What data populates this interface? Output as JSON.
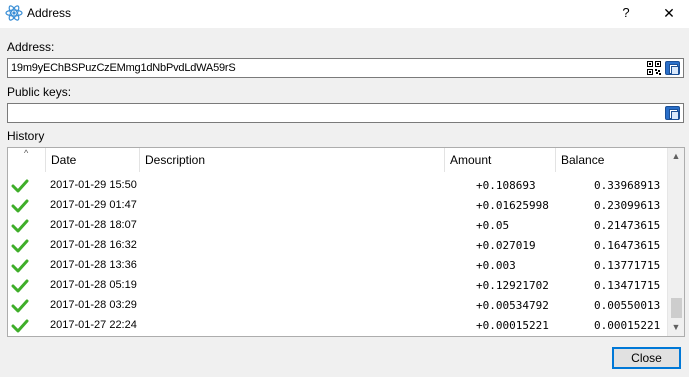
{
  "window": {
    "title": "Address",
    "help_label": "?",
    "close_label": "✕",
    "icon": "electrum-icon"
  },
  "address": {
    "label": "Address:",
    "value": "19m9yEChBSPuzCzEMmg1dNbPvdLdWA59rS",
    "qr_icon": "qr-code-icon",
    "copy_icon": "copy-icon"
  },
  "public_keys": {
    "label": "Public keys:",
    "value": "",
    "copy_icon": "copy-icon"
  },
  "history": {
    "label": "History",
    "columns": [
      "Date",
      "Description",
      "Amount",
      "Balance"
    ],
    "rows": [
      {
        "status": "confirmed-check-icon",
        "date": "2017-01-29 15:50",
        "description": "",
        "amount": "+0.108693",
        "balance": "0.33968913"
      },
      {
        "status": "confirmed-check-icon",
        "date": "2017-01-29 01:47",
        "description": "",
        "amount": "+0.01625998",
        "balance": "0.23099613"
      },
      {
        "status": "confirmed-check-icon",
        "date": "2017-01-28 18:07",
        "description": "",
        "amount": "+0.05",
        "balance": "0.21473615"
      },
      {
        "status": "confirmed-check-icon",
        "date": "2017-01-28 16:32",
        "description": "",
        "amount": "+0.027019",
        "balance": "0.16473615"
      },
      {
        "status": "confirmed-check-icon",
        "date": "2017-01-28 13:36",
        "description": "",
        "amount": "+0.003",
        "balance": "0.13771715"
      },
      {
        "status": "confirmed-check-icon",
        "date": "2017-01-28 05:19",
        "description": "",
        "amount": "+0.12921702",
        "balance": "0.13471715"
      },
      {
        "status": "confirmed-check-icon",
        "date": "2017-01-28 03:29",
        "description": "",
        "amount": "+0.00534792",
        "balance": "0.00550013"
      },
      {
        "status": "confirmed-check-icon",
        "date": "2017-01-27 22:24",
        "description": "",
        "amount": "+0.00015221",
        "balance": "0.00015221"
      }
    ],
    "scroll_fraction": 0.95
  },
  "buttons": {
    "close_label": "Close"
  },
  "colors": {
    "accent": "#0078d7",
    "check": "#3fae2a",
    "copy_button": "#2a6fc9"
  }
}
